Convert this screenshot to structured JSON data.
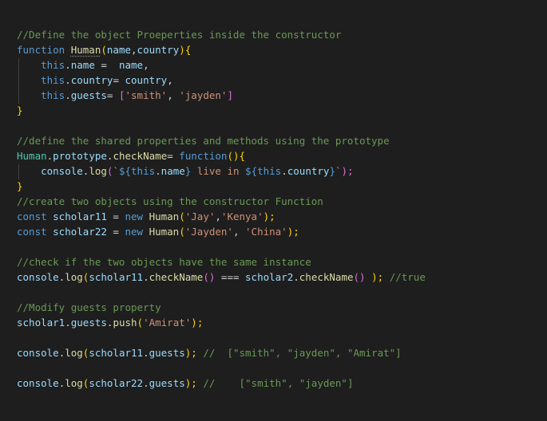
{
  "editor": {
    "background": "#1e1e1e",
    "lines": [
      [
        {
          "t": "//Define the object Proeperties inside the constructor",
          "c": "comment"
        }
      ],
      [
        {
          "t": "function ",
          "c": "kw"
        },
        {
          "t": "Human",
          "c": "fn",
          "squiggle": true
        },
        {
          "t": "(",
          "c": "br1"
        },
        {
          "t": "name",
          "c": "param"
        },
        {
          "t": ",",
          "c": "plain"
        },
        {
          "t": "country",
          "c": "param"
        },
        {
          "t": "){",
          "c": "br1"
        }
      ],
      [
        {
          "t": "    ",
          "c": "plain"
        },
        {
          "t": "this",
          "c": "kw"
        },
        {
          "t": ".",
          "c": "plain"
        },
        {
          "t": "name",
          "c": "param"
        },
        {
          "t": " =  ",
          "c": "plain"
        },
        {
          "t": "name",
          "c": "param"
        },
        {
          "t": ",",
          "c": "plain"
        }
      ],
      [
        {
          "t": "    ",
          "c": "plain"
        },
        {
          "t": "this",
          "c": "kw"
        },
        {
          "t": ".",
          "c": "plain"
        },
        {
          "t": "country",
          "c": "param"
        },
        {
          "t": "= ",
          "c": "plain"
        },
        {
          "t": "country",
          "c": "param"
        },
        {
          "t": ",",
          "c": "plain"
        }
      ],
      [
        {
          "t": "    ",
          "c": "plain"
        },
        {
          "t": "this",
          "c": "kw"
        },
        {
          "t": ".",
          "c": "plain"
        },
        {
          "t": "guests",
          "c": "param"
        },
        {
          "t": "= ",
          "c": "plain"
        },
        {
          "t": "[",
          "c": "br2"
        },
        {
          "t": "'smith'",
          "c": "str"
        },
        {
          "t": ", ",
          "c": "plain"
        },
        {
          "t": "'jayden'",
          "c": "str"
        },
        {
          "t": "]",
          "c": "br2"
        }
      ],
      [
        {
          "t": "}",
          "c": "br1"
        }
      ],
      [],
      [
        {
          "t": "//define the shared properties and methods using the prototype",
          "c": "comment"
        }
      ],
      [
        {
          "t": "Human",
          "c": "type"
        },
        {
          "t": ".",
          "c": "plain"
        },
        {
          "t": "prototype",
          "c": "param"
        },
        {
          "t": ".",
          "c": "plain"
        },
        {
          "t": "checkName",
          "c": "fn"
        },
        {
          "t": "= ",
          "c": "plain"
        },
        {
          "t": "function",
          "c": "kw"
        },
        {
          "t": "(){",
          "c": "br1"
        }
      ],
      [
        {
          "t": "    ",
          "c": "plain"
        },
        {
          "t": "console",
          "c": "param"
        },
        {
          "t": ".",
          "c": "plain"
        },
        {
          "t": "log",
          "c": "fn"
        },
        {
          "t": "(",
          "c": "br2"
        },
        {
          "t": "`",
          "c": "str"
        },
        {
          "t": "${",
          "c": "kw"
        },
        {
          "t": "this",
          "c": "kw"
        },
        {
          "t": ".",
          "c": "plain"
        },
        {
          "t": "name",
          "c": "param"
        },
        {
          "t": "}",
          "c": "kw"
        },
        {
          "t": " live in ",
          "c": "str"
        },
        {
          "t": "${",
          "c": "kw"
        },
        {
          "t": "this",
          "c": "kw"
        },
        {
          "t": ".",
          "c": "plain"
        },
        {
          "t": "country",
          "c": "param"
        },
        {
          "t": "}",
          "c": "kw"
        },
        {
          "t": "`",
          "c": "str"
        },
        {
          "t": ");",
          "c": "br2"
        }
      ],
      [
        {
          "t": "}",
          "c": "br1"
        }
      ],
      [
        {
          "t": "//create two objects using the constructor Function",
          "c": "comment"
        }
      ],
      [
        {
          "t": "const ",
          "c": "kw"
        },
        {
          "t": "scholar11",
          "c": "param"
        },
        {
          "t": " = ",
          "c": "plain"
        },
        {
          "t": "new ",
          "c": "kw"
        },
        {
          "t": "Human",
          "c": "fn"
        },
        {
          "t": "(",
          "c": "br1"
        },
        {
          "t": "'Jay'",
          "c": "str"
        },
        {
          "t": ",",
          "c": "plain"
        },
        {
          "t": "'Kenya'",
          "c": "str"
        },
        {
          "t": ");",
          "c": "br1"
        }
      ],
      [
        {
          "t": "const ",
          "c": "kw"
        },
        {
          "t": "scholar22",
          "c": "param"
        },
        {
          "t": " = ",
          "c": "plain"
        },
        {
          "t": "new ",
          "c": "kw"
        },
        {
          "t": "Human",
          "c": "fn"
        },
        {
          "t": "(",
          "c": "br1"
        },
        {
          "t": "'Jayden'",
          "c": "str"
        },
        {
          "t": ", ",
          "c": "plain"
        },
        {
          "t": "'China'",
          "c": "str"
        },
        {
          "t": ");",
          "c": "br1"
        }
      ],
      [],
      [
        {
          "t": "//check if the two objects have the same instance",
          "c": "comment"
        }
      ],
      [
        {
          "t": "console",
          "c": "param"
        },
        {
          "t": ".",
          "c": "plain"
        },
        {
          "t": "log",
          "c": "fn"
        },
        {
          "t": "(",
          "c": "br1"
        },
        {
          "t": "scholar11",
          "c": "param"
        },
        {
          "t": ".",
          "c": "plain"
        },
        {
          "t": "checkName",
          "c": "fn"
        },
        {
          "t": "()",
          "c": "br2"
        },
        {
          "t": " === ",
          "c": "plain"
        },
        {
          "t": "scholar2",
          "c": "param"
        },
        {
          "t": ".",
          "c": "plain"
        },
        {
          "t": "checkName",
          "c": "fn"
        },
        {
          "t": "()",
          "c": "br2"
        },
        {
          "t": " ",
          "c": "plain"
        },
        {
          "t": ");",
          "c": "br1"
        },
        {
          "t": " //true",
          "c": "comment"
        }
      ],
      [],
      [
        {
          "t": "//Modify guests property",
          "c": "comment"
        }
      ],
      [
        {
          "t": "scholar1",
          "c": "param"
        },
        {
          "t": ".",
          "c": "plain"
        },
        {
          "t": "guests",
          "c": "param"
        },
        {
          "t": ".",
          "c": "plain"
        },
        {
          "t": "push",
          "c": "fn"
        },
        {
          "t": "(",
          "c": "br1"
        },
        {
          "t": "'Amirat'",
          "c": "str"
        },
        {
          "t": ");",
          "c": "br1"
        }
      ],
      [],
      [
        {
          "t": "console",
          "c": "param"
        },
        {
          "t": ".",
          "c": "plain"
        },
        {
          "t": "log",
          "c": "fn"
        },
        {
          "t": "(",
          "c": "br1"
        },
        {
          "t": "scholar11",
          "c": "param"
        },
        {
          "t": ".",
          "c": "plain"
        },
        {
          "t": "guests",
          "c": "param"
        },
        {
          "t": ");",
          "c": "br1"
        },
        {
          "t": " //  [\"smith\", \"jayden\", \"Amirat\"]",
          "c": "comment"
        }
      ],
      [],
      [
        {
          "t": "console",
          "c": "param"
        },
        {
          "t": ".",
          "c": "plain"
        },
        {
          "t": "log",
          "c": "fn"
        },
        {
          "t": "(",
          "c": "br1"
        },
        {
          "t": "scholar22",
          "c": "param"
        },
        {
          "t": ".",
          "c": "plain"
        },
        {
          "t": "guests",
          "c": "param"
        },
        {
          "t": ");",
          "c": "br1"
        },
        {
          "t": " //    [\"smith\", \"jayden\"]",
          "c": "comment"
        }
      ]
    ]
  }
}
